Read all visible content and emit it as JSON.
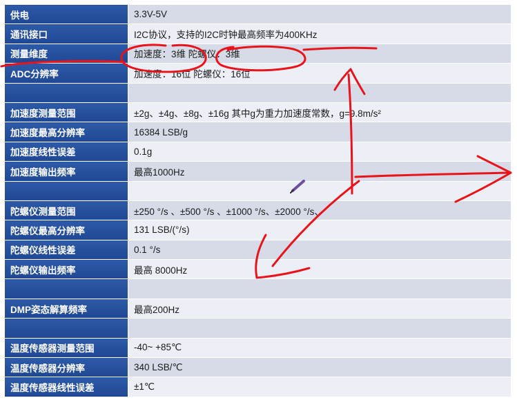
{
  "rows": [
    {
      "label": "供电",
      "value": "3.3V-5V"
    },
    {
      "label": "通讯接口",
      "value": "I2C协议，支持的I2C时钟最高频率为400KHz"
    },
    {
      "label": "测量维度",
      "value": "加速度：3维     陀螺仪：3维"
    },
    {
      "label": "ADC分辨率",
      "value": "加速度：16位     陀螺仪：16位"
    },
    {
      "label": "",
      "value": ""
    },
    {
      "label": "加速度测量范围",
      "value": "±2g、±4g、±8g、±16g     其中g为重力加速度常数，g=9.8m/s²"
    },
    {
      "label": "加速度最高分辨率",
      "value": "16384 LSB/g"
    },
    {
      "label": "加速度线性误差",
      "value": "0.1g"
    },
    {
      "label": "加速度输出频率",
      "value": "最高1000Hz"
    },
    {
      "label": "",
      "value": ""
    },
    {
      "label": "陀螺仪测量范围",
      "value": "±250 °/s 、±500 °/s 、±1000 °/s、±2000 °/s、"
    },
    {
      "label": "陀螺仪最高分辨率",
      "value": "131 LSB/(°/s)"
    },
    {
      "label": "陀螺仪线性误差",
      "value": "0.1 °/s"
    },
    {
      "label": "陀螺仪输出频率",
      "value": "最高 8000Hz"
    },
    {
      "label": "",
      "value": ""
    },
    {
      "label": "DMP姿态解算频率",
      "value": "最高200Hz"
    },
    {
      "label": "",
      "value": ""
    },
    {
      "label": "温度传感器测量范围",
      "value": "-40~ +85℃"
    },
    {
      "label": "温度传感器分辨率",
      "value": "340 LSB/℃"
    },
    {
      "label": "温度传感器线性误差",
      "value": "±1℃"
    }
  ],
  "colors": {
    "label_bg": "#2456a4",
    "row_odd": "#d6dbe7",
    "row_even": "#eceff5",
    "annotation": "#e8141b"
  }
}
